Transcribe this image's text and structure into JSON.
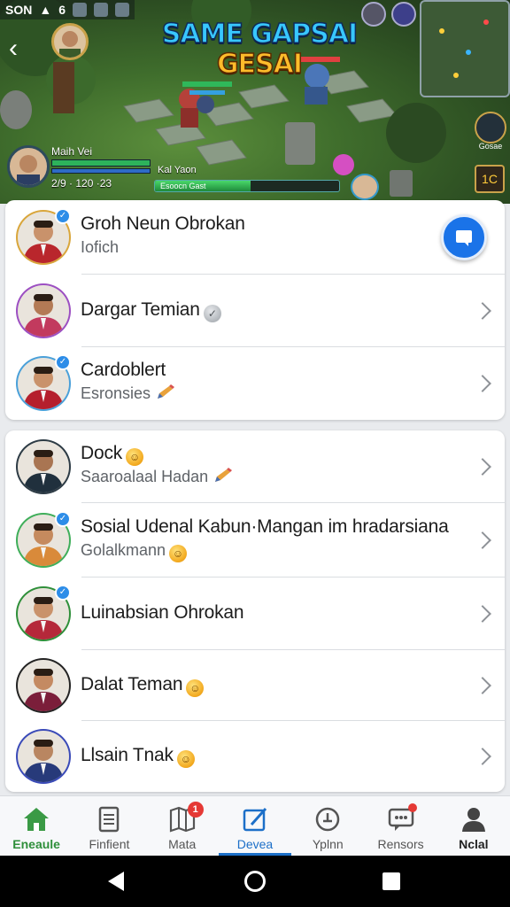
{
  "status_bar": {
    "time": "SON",
    "signal": "6"
  },
  "banner": {
    "title_line1": "SAME GAPSAI",
    "title_line2": "GESAI",
    "player_name": "Maih Vei",
    "player_stats": "2/9 · 120 ·23",
    "enemy_name": "Kal Yaon",
    "enemy_tag": "Rian",
    "progress_label": "Esoocn Gast",
    "progress_value": 0.52,
    "side_text": "Gosae",
    "side_badge": "1C"
  },
  "friends": {
    "top": [
      {
        "name": "Groh Neun Obrokan",
        "sub": "Iofich",
        "verified": true,
        "ring": "#d9a63b",
        "accent": "#b9262c",
        "skin": "#c9926b"
      },
      {
        "name": "Dargar Temian",
        "sub": "",
        "verified": false,
        "ring": "#9c4fc2",
        "accent": "#c23a5e",
        "skin": "#b37a55",
        "badge": "grey-check"
      },
      {
        "name": "Cardoblert",
        "sub": "Esronsies",
        "verified": true,
        "ring": "#4aa0d9",
        "accent": "#b51f2d",
        "skin": "#c9926b",
        "sub_icon": "pencil"
      }
    ],
    "bottom": [
      {
        "name": "Dock",
        "sub": "Saaroalaal Hadan",
        "verified": false,
        "ring": "#2d3b45",
        "accent": "#20303d",
        "skin": "#a97552",
        "title_emoji": true,
        "sub_icon": "pencil"
      },
      {
        "name": "Sosial Udenal Kabun·Mangan im hradarsiana",
        "sub": "Golalkmann",
        "verified": true,
        "ring": "#3fae5a",
        "accent": "#d98a3a",
        "skin": "#c58a5e",
        "sub_emoji": true
      },
      {
        "name": "Luinabsian Ohrokan",
        "sub": "",
        "verified": true,
        "ring": "#2f8f3a",
        "accent": "#b5283a",
        "skin": "#c9926b"
      },
      {
        "name": "Dalat Teman",
        "sub": "",
        "verified": false,
        "ring": "#232323",
        "accent": "#7b1e3a",
        "skin": "#c48a62",
        "title_emoji": true
      },
      {
        "name": "Llsain Tnak",
        "sub": "",
        "verified": false,
        "ring": "#3a4ab8",
        "accent": "#273a7a",
        "skin": "#b98661",
        "title_emoji": true
      }
    ]
  },
  "nav": [
    {
      "label": "Eneaule",
      "icon": "home-icon",
      "state": "home",
      "badge": ""
    },
    {
      "label": "Finfient",
      "icon": "document-icon",
      "state": "",
      "badge": ""
    },
    {
      "label": "Mata",
      "icon": "map-icon",
      "state": "",
      "badge": "1"
    },
    {
      "label": "Devea",
      "icon": "edit-icon",
      "state": "active",
      "badge": ""
    },
    {
      "label": "Yplnn",
      "icon": "compass-icon",
      "state": "",
      "badge": ""
    },
    {
      "label": "Rensors",
      "icon": "chat-icon",
      "state": "",
      "badge": "dot"
    },
    {
      "label": "Nclal",
      "icon": "person-icon",
      "state": "bold",
      "badge": ""
    }
  ],
  "colors": {
    "accent_blue": "#1c6fc8",
    "home_green": "#2f8f3a",
    "verified_blue": "#2d8de8",
    "badge_red": "#e53935"
  }
}
